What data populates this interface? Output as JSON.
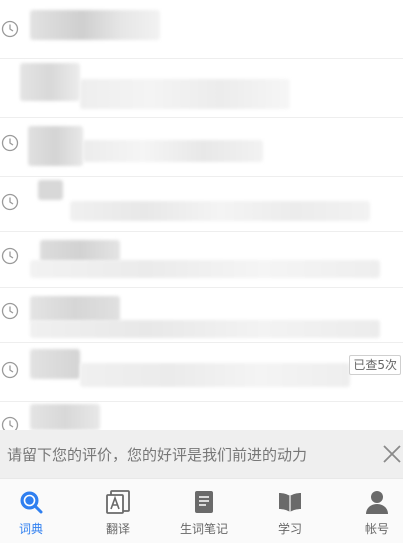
{
  "history": {
    "items": [
      {
        "count_badge": ""
      },
      {
        "count_badge": ""
      },
      {
        "count_badge": ""
      },
      {
        "count_badge": ""
      },
      {
        "count_badge": ""
      },
      {
        "count_badge": ""
      },
      {
        "count_badge": "已查5次"
      },
      {
        "count_badge": ""
      }
    ]
  },
  "feedback": {
    "text": "请留下您的评价，您的好评是我们前进的动力"
  },
  "tabs": [
    {
      "label": "词典",
      "icon": "dictionary-search-icon",
      "active": true
    },
    {
      "label": "翻译",
      "icon": "translate-icon",
      "active": false
    },
    {
      "label": "生词笔记",
      "icon": "notebook-icon",
      "active": false
    },
    {
      "label": "学习",
      "icon": "book-icon",
      "active": false
    },
    {
      "label": "帐号",
      "icon": "user-icon",
      "active": false
    }
  ],
  "colors": {
    "accent": "#2f7ff0",
    "banner_bg": "#efefef",
    "tab_inactive": "#666666"
  }
}
